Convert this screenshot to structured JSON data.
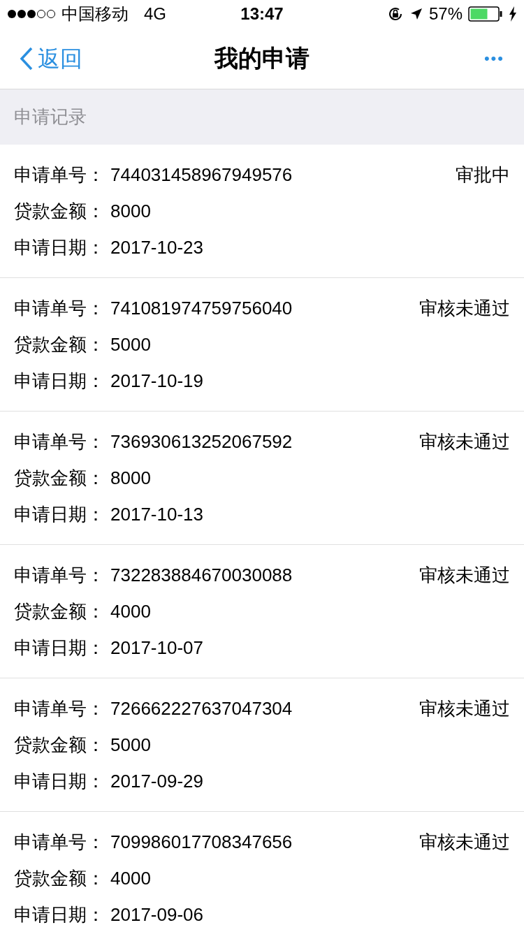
{
  "status_bar": {
    "carrier": "中国移动",
    "network": "4G",
    "time": "13:47",
    "battery": "57%"
  },
  "nav_bar": {
    "back": "返回",
    "title": "我的申请",
    "more": "•••"
  },
  "section_header": "申请记录",
  "applications": [
    {
      "fields": [
        {
          "label": "申请单号：",
          "value": "744031458967949576"
        },
        {
          "label": "贷款金额：",
          "value": "8000"
        },
        {
          "label": "申请日期：",
          "value": "2017-10-23"
        }
      ],
      "status": "审批中"
    },
    {
      "fields": [
        {
          "label": "申请单号：",
          "value": "741081974759756040"
        },
        {
          "label": "贷款金额：",
          "value": "5000"
        },
        {
          "label": "申请日期：",
          "value": "2017-10-19"
        }
      ],
      "status": "审核未通过"
    },
    {
      "fields": [
        {
          "label": "申请单号：",
          "value": "736930613252067592"
        },
        {
          "label": "贷款金额：",
          "value": "8000"
        },
        {
          "label": "申请日期：",
          "value": "2017-10-13"
        }
      ],
      "status": "审核未通过"
    },
    {
      "fields": [
        {
          "label": "申请单号：",
          "value": "732283884670030088"
        },
        {
          "label": "贷款金额：",
          "value": "4000"
        },
        {
          "label": "申请日期：",
          "value": "2017-10-07"
        }
      ],
      "status": "审核未通过"
    },
    {
      "fields": [
        {
          "label": "申请单号：",
          "value": "726662227637047304"
        },
        {
          "label": "贷款金额：",
          "value": "5000"
        },
        {
          "label": "申请日期：",
          "value": "2017-09-29"
        }
      ],
      "status": "审核未通过"
    },
    {
      "fields": [
        {
          "label": "申请单号：",
          "value": "709986017708347656"
        },
        {
          "label": "贷款金额：",
          "value": "4000"
        },
        {
          "label": "申请日期：",
          "value": "2017-09-06"
        }
      ],
      "status": "审核未通过"
    }
  ]
}
